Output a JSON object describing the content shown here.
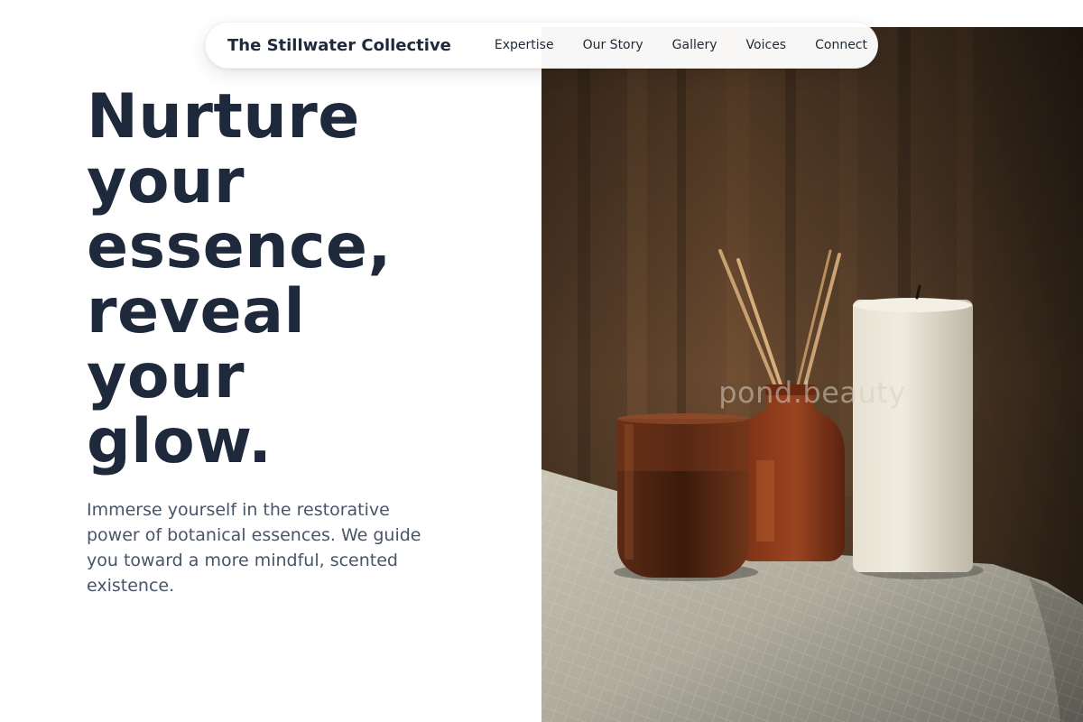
{
  "nav": {
    "brand": "The Stillwater Collective",
    "links": [
      {
        "label": "Expertise"
      },
      {
        "label": "Our Story"
      },
      {
        "label": "Gallery"
      },
      {
        "label": "Voices"
      },
      {
        "label": "Connect"
      }
    ]
  },
  "hero": {
    "headline_lines": [
      "Nurture",
      "your",
      "essence,",
      "reveal",
      "your",
      "glow."
    ],
    "description": "Immerse yourself in the restorative power of botanical essences. We guide you toward a more mindful, scented existence.",
    "image": {
      "watermark": "pond.beauty",
      "subject": "candle-and-reed-diffuser-still-life"
    }
  },
  "colors": {
    "headline": "#1e293b",
    "body_text": "#475569",
    "nav_text": "#1f2937",
    "background": "#ffffff"
  }
}
